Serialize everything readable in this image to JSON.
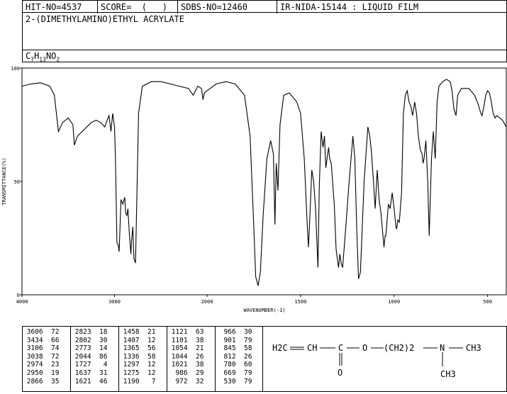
{
  "header": {
    "hit_no": "HIT-NO=4537",
    "score": "SCORE=  (   )",
    "sdbs_no": "SDBS-NO=12460",
    "ir": "IR-NIDA-15144 : LIQUID FILM"
  },
  "compound_name": "2-(DIMETHYLAMINO)ETHYL ACRYLATE",
  "formula": {
    "c": "C",
    "c_n": "7",
    "h": "H",
    "h_n": "13",
    "n": "NO",
    "o_n": "2"
  },
  "chart_data": {
    "type": "line",
    "xlabel": "WAVENUMBER(-1)",
    "ylabel": "TRANSMITTANCE(%)",
    "xlim": [
      4000,
      400
    ],
    "ylim": [
      0,
      100
    ],
    "x_ticks": [
      4000,
      3000,
      2000,
      1500,
      1000,
      500
    ],
    "y_ticks": [
      0,
      50,
      100
    ],
    "series": [
      {
        "points": [
          [
            4000,
            92
          ],
          [
            3900,
            93
          ],
          [
            3800,
            93.5
          ],
          [
            3700,
            92
          ],
          [
            3650,
            88
          ],
          [
            3606,
            72
          ],
          [
            3560,
            76
          ],
          [
            3500,
            78
          ],
          [
            3450,
            75
          ],
          [
            3434,
            66
          ],
          [
            3400,
            70
          ],
          [
            3350,
            72
          ],
          [
            3300,
            74
          ],
          [
            3250,
            76
          ],
          [
            3200,
            77
          ],
          [
            3150,
            76
          ],
          [
            3106,
            74
          ],
          [
            3080,
            77
          ],
          [
            3060,
            79
          ],
          [
            3038,
            72
          ],
          [
            3020,
            80
          ],
          [
            3000,
            74
          ],
          [
            2990,
            60
          ],
          [
            2974,
            23
          ],
          [
            2960,
            22
          ],
          [
            2950,
            19
          ],
          [
            2940,
            30
          ],
          [
            2930,
            42
          ],
          [
            2910,
            40
          ],
          [
            2890,
            43
          ],
          [
            2880,
            36
          ],
          [
            2866,
            35
          ],
          [
            2855,
            38
          ],
          [
            2840,
            27
          ],
          [
            2823,
            18
          ],
          [
            2815,
            24
          ],
          [
            2802,
            30
          ],
          [
            2790,
            16
          ],
          [
            2773,
            14
          ],
          [
            2760,
            40
          ],
          [
            2740,
            80
          ],
          [
            2700,
            92
          ],
          [
            2600,
            94
          ],
          [
            2500,
            94
          ],
          [
            2400,
            93
          ],
          [
            2300,
            92
          ],
          [
            2200,
            91
          ],
          [
            2150,
            88
          ],
          [
            2100,
            92
          ],
          [
            2060,
            91
          ],
          [
            2044,
            86
          ],
          [
            2030,
            89
          ],
          [
            2000,
            90
          ],
          [
            1950,
            93
          ],
          [
            1900,
            94
          ],
          [
            1850,
            93
          ],
          [
            1800,
            88
          ],
          [
            1770,
            70
          ],
          [
            1750,
            30
          ],
          [
            1740,
            8
          ],
          [
            1727,
            4
          ],
          [
            1715,
            10
          ],
          [
            1700,
            35
          ],
          [
            1680,
            60
          ],
          [
            1660,
            68
          ],
          [
            1645,
            62
          ],
          [
            1637,
            31
          ],
          [
            1630,
            58
          ],
          [
            1621,
            46
          ],
          [
            1610,
            75
          ],
          [
            1590,
            88
          ],
          [
            1560,
            89
          ],
          [
            1520,
            85
          ],
          [
            1500,
            80
          ],
          [
            1480,
            60
          ],
          [
            1465,
            32
          ],
          [
            1458,
            21
          ],
          [
            1450,
            35
          ],
          [
            1440,
            55
          ],
          [
            1430,
            50
          ],
          [
            1420,
            38
          ],
          [
            1407,
            12
          ],
          [
            1400,
            48
          ],
          [
            1390,
            72
          ],
          [
            1380,
            65
          ],
          [
            1372,
            70
          ],
          [
            1365,
            56
          ],
          [
            1350,
            65
          ],
          [
            1344,
            60
          ],
          [
            1336,
            58
          ],
          [
            1320,
            40
          ],
          [
            1310,
            20
          ],
          [
            1297,
            12
          ],
          [
            1290,
            18
          ],
          [
            1283,
            14
          ],
          [
            1275,
            12
          ],
          [
            1260,
            28
          ],
          [
            1240,
            50
          ],
          [
            1220,
            70
          ],
          [
            1210,
            60
          ],
          [
            1200,
            30
          ],
          [
            1190,
            7
          ],
          [
            1180,
            10
          ],
          [
            1160,
            50
          ],
          [
            1140,
            74
          ],
          [
            1130,
            70
          ],
          [
            1121,
            63
          ],
          [
            1110,
            50
          ],
          [
            1101,
            38
          ],
          [
            1090,
            55
          ],
          [
            1080,
            42
          ],
          [
            1070,
            36
          ],
          [
            1054,
            21
          ],
          [
            1048,
            26
          ],
          [
            1044,
            26
          ],
          [
            1030,
            40
          ],
          [
            1021,
            38
          ],
          [
            1010,
            45
          ],
          [
            1000,
            38
          ],
          [
            990,
            30
          ],
          [
            986,
            29
          ],
          [
            980,
            33
          ],
          [
            972,
            32
          ],
          [
            960,
            45
          ],
          [
            950,
            80
          ],
          [
            940,
            88
          ],
          [
            930,
            90
          ],
          [
            920,
            85
          ],
          [
            910,
            83
          ],
          [
            901,
            79
          ],
          [
            890,
            85
          ],
          [
            880,
            80
          ],
          [
            870,
            70
          ],
          [
            860,
            64
          ],
          [
            850,
            62
          ],
          [
            845,
            58
          ],
          [
            840,
            60
          ],
          [
            830,
            68
          ],
          [
            820,
            50
          ],
          [
            812,
            26
          ],
          [
            800,
            60
          ],
          [
            790,
            72
          ],
          [
            780,
            60
          ],
          [
            770,
            85
          ],
          [
            760,
            92
          ],
          [
            740,
            94
          ],
          [
            720,
            95
          ],
          [
            700,
            94
          ],
          [
            690,
            90
          ],
          [
            680,
            82
          ],
          [
            669,
            79
          ],
          [
            660,
            88
          ],
          [
            640,
            91
          ],
          [
            600,
            91
          ],
          [
            570,
            88
          ],
          [
            550,
            84
          ],
          [
            540,
            81
          ],
          [
            530,
            79
          ],
          [
            520,
            83
          ],
          [
            510,
            88
          ],
          [
            500,
            90
          ],
          [
            490,
            89
          ],
          [
            480,
            85
          ],
          [
            470,
            80
          ],
          [
            460,
            78
          ],
          [
            450,
            79
          ],
          [
            420,
            77
          ],
          [
            400,
            74
          ]
        ]
      }
    ]
  },
  "peak_table": [
    [
      [
        "3606",
        "72"
      ],
      [
        "3434",
        "66"
      ],
      [
        "3106",
        "74"
      ],
      [
        "3038",
        "72"
      ],
      [
        "2974",
        "23"
      ],
      [
        "2950",
        "19"
      ],
      [
        "2866",
        "35"
      ]
    ],
    [
      [
        "2823",
        "18"
      ],
      [
        "2802",
        "30"
      ],
      [
        "2773",
        "14"
      ],
      [
        "2044",
        "86"
      ],
      [
        "1727",
        "4"
      ],
      [
        "1637",
        "31"
      ],
      [
        "1621",
        "46"
      ]
    ],
    [
      [
        "1458",
        "21"
      ],
      [
        "1407",
        "12"
      ],
      [
        "1365",
        "56"
      ],
      [
        "1336",
        "58"
      ],
      [
        "1297",
        "12"
      ],
      [
        "1275",
        "12"
      ],
      [
        "1190",
        "7"
      ]
    ],
    [
      [
        "1121",
        "63"
      ],
      [
        "1101",
        "38"
      ],
      [
        "1054",
        "21"
      ],
      [
        "1044",
        "26"
      ],
      [
        "1021",
        "38"
      ],
      [
        "986",
        "29"
      ],
      [
        "972",
        "32"
      ]
    ],
    [
      [
        "966",
        "30"
      ],
      [
        "901",
        "79"
      ],
      [
        "845",
        "58"
      ],
      [
        "812",
        "26"
      ],
      [
        "780",
        "60"
      ],
      [
        "669",
        "79"
      ],
      [
        "530",
        "79"
      ]
    ]
  ],
  "structure": {
    "h2c": "H2C",
    "ch": "CH",
    "c": "C",
    "o": "O",
    "o2": "O",
    "n": "N",
    "ch2": "(CH2)2",
    "ch3_a": "CH3",
    "ch3_b": "CH3"
  }
}
